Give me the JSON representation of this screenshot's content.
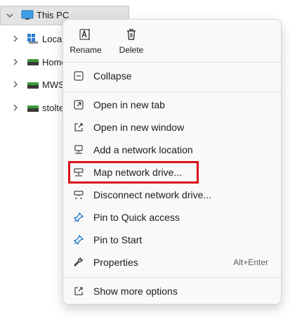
{
  "nav": {
    "this_pc": "This PC",
    "children": [
      "Local",
      "Home",
      "MWS",
      "stolte"
    ]
  },
  "menu": {
    "quick_actions": {
      "rename": "Rename",
      "delete": "Delete"
    },
    "items": {
      "collapse": "Collapse",
      "open_new_tab": "Open in new tab",
      "open_new_window": "Open in new window",
      "add_network_location": "Add a network location",
      "map_network_drive": "Map network drive...",
      "disconnect_network_drive": "Disconnect network drive...",
      "pin_quick_access": "Pin to Quick access",
      "pin_start": "Pin to Start",
      "properties": "Properties",
      "properties_shortcut": "Alt+Enter",
      "show_more_options": "Show more options"
    },
    "highlight_color": "#d7141a",
    "accent_color": "#0067c0"
  }
}
